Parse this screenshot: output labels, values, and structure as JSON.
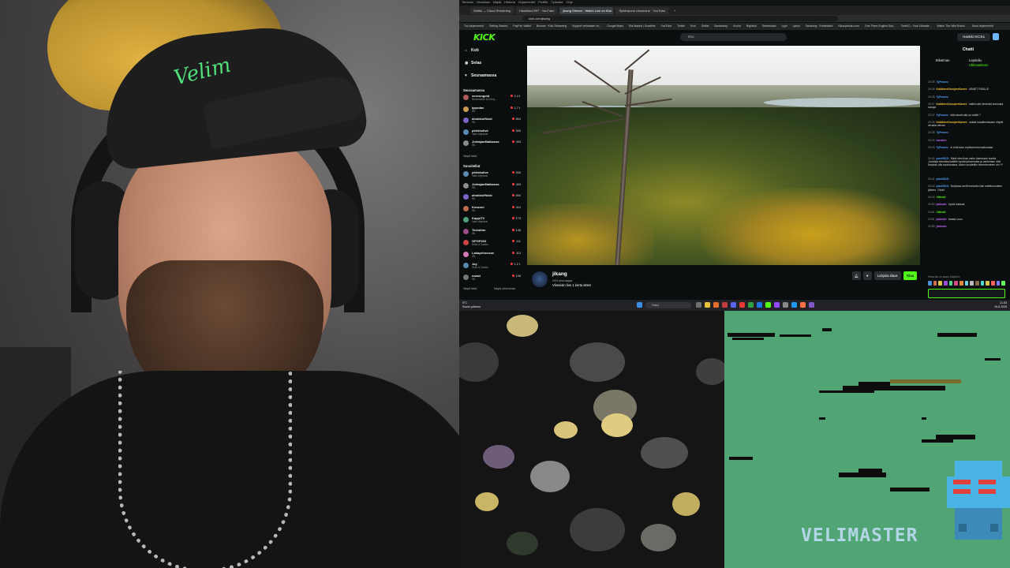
{
  "browser": {
    "menu": [
      "Tiedosto",
      "Muokkaa",
      "Näytä",
      "Historia",
      "Kirjanmerkit",
      "Profiilit",
      "Työkalut",
      "Ohje"
    ],
    "tabs": [
      {
        "label": "Settlis — Cloud Streaming"
      },
      {
        "label": "Hashikku1997 · YouTube"
      },
      {
        "label": "jikang Stream · Watch Live on Kick"
      },
      {
        "label": "Spiderpunk Uncoushe · YouTube"
      }
    ],
    "url": "kick.com/jikang",
    "bookmarks": [
      "Tuo kirjanmerkit",
      "Getting Started",
      "PayPal: Wallet",
      "Browse · Kick Streaming",
      "Support velimaster on...",
      "Google Maps",
      "Etsi tilastot | Scrabble",
      "YouTube",
      "Twitch",
      "Kick",
      "Settlis",
      "Bandcamp",
      "Kuviot",
      "Nightbot",
      "Streamlabs",
      "Lyyti",
      "Lyrics",
      "Samsung · Embedded",
      "Kikospesutu.com",
      "One Piece English Sub...",
      "GeeKO - Your Ultimate...",
      "Watch The Wild Robot...",
      "Muut kirjanmerkit"
    ]
  },
  "kick": {
    "logo": "KICK",
    "search_placeholder": "Etsi",
    "login_button": "Hankki KICKs",
    "nav": [
      {
        "icon": "home-icon",
        "label": "Koti"
      },
      {
        "icon": "compass-icon",
        "label": "Selaa"
      },
      {
        "icon": "heart-icon",
        "label": "Seuraamassa"
      }
    ],
    "following_title": "Seuraamassa",
    "following": [
      {
        "name": "seeeongold",
        "game": "Neverwinter is Every...",
        "viewers": "2,4 t.",
        "color": "#b35b5b"
      },
      {
        "name": "Ippodav",
        "game": "IRL",
        "viewers": "1,7 t.",
        "color": "#c99a52"
      },
      {
        "name": "ahokkiofficial",
        "game": "IRL",
        "viewers": "804",
        "color": "#7d62c9"
      },
      {
        "name": "pirkkisdive",
        "game": "Valm.ohjelmat",
        "viewers": "526",
        "color": "#5a8bb5"
      },
      {
        "name": "JohtajanMatkassa",
        "game": "IRL",
        "viewers": "453",
        "color": "#8d8d8d"
      }
    ],
    "show_all_following": "Näytä lisää",
    "recommended_title": "Suositellut",
    "recommended": [
      {
        "name": "pirkkisdive",
        "game": "Valm.ohjelmat",
        "viewers": "526",
        "color": "#5a8bb5"
      },
      {
        "name": "JohtajanMatkassa",
        "game": "IRL",
        "viewers": "453",
        "color": "#8d8d8d"
      },
      {
        "name": "ahokkiofficial",
        "game": "IRL",
        "viewers": "804",
        "color": "#7d62c9"
      },
      {
        "name": "Kosseni",
        "game": "IRL",
        "viewers": "410",
        "color": "#c06c4a"
      },
      {
        "name": "KappiTV",
        "game": "Valm.ohjelmat",
        "viewers": "173",
        "color": "#4ea37a"
      },
      {
        "name": "Teslothm",
        "game": "IRL",
        "viewers": "146",
        "color": "#9b4d86"
      },
      {
        "name": "GPGP333",
        "game": "Slots & Casino",
        "viewers": "111",
        "color": "#c44"
      },
      {
        "name": "Ladaprincesse",
        "game": "IRL",
        "viewers": "113",
        "color": "#d17ab7"
      },
      {
        "name": "Jay",
        "game": "Slots & Casino",
        "viewers": "1,2 t.",
        "color": "#58a"
      },
      {
        "name": "ezaa4",
        "game": "IRL",
        "viewers": "108",
        "color": "#777"
      }
    ],
    "show_more": "Näytä lisää",
    "show_less": "Näytä vähemmän"
  },
  "stream": {
    "channel": "jikang",
    "followers": "245 seuraajaa",
    "title": "Viimeisin live 1 kerta sitten",
    "subscribe_button": "Lahjoita tilaus",
    "follow_button": "Tilaa"
  },
  "chat": {
    "title": "Chatti",
    "pinned": [
      {
        "name": "Biketman",
        "color": "#f1c232"
      },
      {
        "name": "Lepindiu",
        "color": "#f1c232"
      },
      {
        "name": "Ultimaattinen",
        "color": "#53fc18"
      }
    ],
    "messages": [
      {
        "time": "20:25",
        "user": "TyPesmo:",
        "color": "#53a1fc",
        "text": ""
      },
      {
        "time": "20:25",
        "user": "KaikkienKissojenKaveri:",
        "color": "#f1c232",
        "text": "ÄÄNET PÄÄLLE"
      },
      {
        "time": "20:25",
        "user": "TyPesmo:",
        "color": "#53a1fc",
        "text": ""
      },
      {
        "time": "20:27",
        "user": "KaikkienKissojenKaveri:",
        "color": "#f1c232",
        "text": "kaikki näit viimeisiä kouluista sanoja"
      },
      {
        "time": "20:27",
        "user": "TyPesmo:",
        "color": "#53a1fc",
        "text": "sitä missä nää on chätti ?"
      },
      {
        "time": "20:28",
        "user": "KaikkienKissojenKaveri:",
        "color": "#f1c232",
        "text": "onkaa maailmoissaan nöyrät siruaka olevan"
      },
      {
        "time": "20:28",
        "user": "TyPesmo:",
        "color": "#53a1fc",
        "text": ""
      },
      {
        "time": "20:29",
        "user": "hardish:",
        "color": "#c86bff",
        "text": ""
      },
      {
        "time": "20:29",
        "user": "TyPesmo:",
        "color": "#53a1fc",
        "text": "ei ehtä tuun myöhemmin kattomaan"
      },
      {
        "time": "20:30",
        "user": "pixel0815:",
        "color": "#53a1fc",
        "text": "Minä olen ihan vaiho lukemaan huutta. Juontaja tolvottaa kaikille hyvää juhannusta ja valhehtaa, että Norjaan olla saolomassa. Aalon soudettiin ihmenierninen ohi :P"
      },
      {
        "time": "20:41",
        "user": "pixel0815:",
        "color": "#53a1fc",
        "text": ""
      },
      {
        "time": "20:42",
        "user": "pixel0815:",
        "color": "#53a1fc",
        "text": "Norjassa revitt merkaitu hati mahtinnuuteen jätteen. Ohoh!"
      },
      {
        "time": "20:43",
        "user": "Villredi:",
        "color": "#53fc18",
        "text": ""
      },
      {
        "time": "20:50",
        "user": "jskinski:",
        "color": "#c86bff",
        "text": "hyviä tuloksia"
      },
      {
        "time": "20:51",
        "user": "Villredi:",
        "color": "#53fc18",
        "text": ""
      },
      {
        "time": "20:51",
        "user": "jskinski:",
        "color": "#c86bff",
        "text": "tarista vuoo"
      },
      {
        "time": "20:53",
        "user": "jskinski:",
        "color": "#c86bff",
        "text": ""
      }
    ],
    "hint": "Hiiaa tila on saatu käyttöön",
    "points": "670",
    "count": "0",
    "send_button": "Chatti"
  },
  "taskbar": {
    "weather": "5°C",
    "weather_desc": "Suurin pilvinen",
    "search": "Haku",
    "time": "21.53",
    "date": "26.6.2025"
  },
  "overlay": {
    "brand": "VELIMASTER",
    "cap_text": "Velim"
  }
}
